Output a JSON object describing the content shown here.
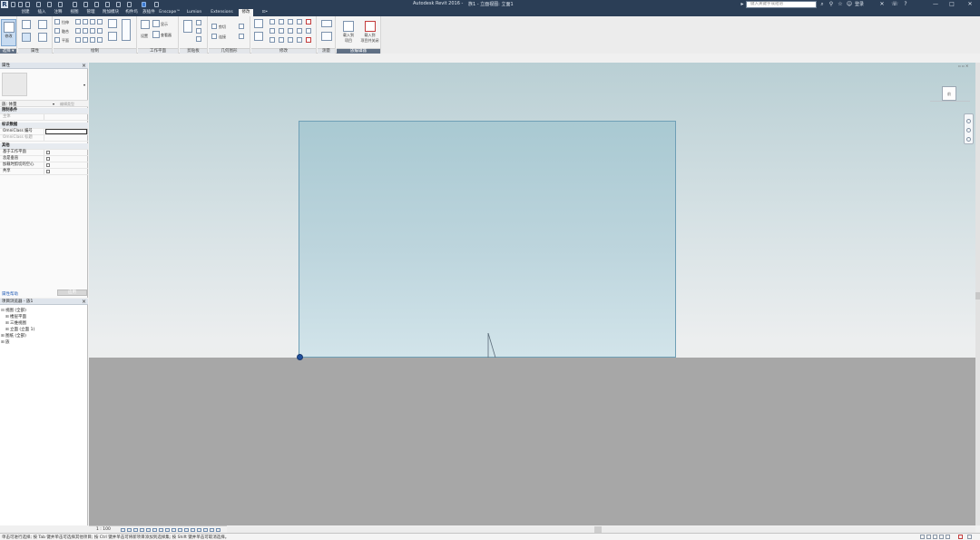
{
  "titlebar": {
    "app_letter": "R",
    "doc_title": "Autodesk Revit 2016 -",
    "view_name": "族1 - 立面视图: 立面1",
    "search_placeholder": "键入关键字或短语",
    "sign_in": "登录",
    "min": "—",
    "max": "□",
    "close": "✕",
    "help": "?"
  },
  "tabs": [
    {
      "label": "创建"
    },
    {
      "label": "插入"
    },
    {
      "label": "注释"
    },
    {
      "label": "视图"
    },
    {
      "label": "管理"
    },
    {
      "label": "附加模块"
    },
    {
      "label": "构件坞"
    },
    {
      "label": "族插件"
    },
    {
      "label": "Enscape™"
    },
    {
      "label": "Lumion"
    },
    {
      "label": "Extensions"
    },
    {
      "label": "修改"
    },
    {
      "label": "⊡•"
    }
  ],
  "ribbon": {
    "select_label": "选择 ▾",
    "properties_label": "属性",
    "draw_label": "绘制",
    "work_plane_label": "工作平面",
    "clipboard_label": "剪贴板",
    "geometry_label": "几何图形",
    "modify_label": "修改",
    "measure_label": "测量",
    "family_editor_label": "族编辑器",
    "modify_btn": "修改",
    "blend_btn": "融合",
    "sweep_btn": "放样",
    "plane_btn": "平面",
    "set_btn": "设置",
    "show_btn": "显示",
    "viewer_btn": "查看器",
    "cut_btn": "剪切",
    "join_btn": "连接",
    "load_project_btn": "载入到\n项目",
    "load_close_btn": "载入到\n项目并关闭"
  },
  "properties": {
    "title": "属性",
    "type_selector": "族: 体量",
    "edit_type": "编辑类型",
    "groups": [
      {
        "name": "限制条件"
      },
      {
        "name": "标识数据"
      },
      {
        "name": "其他"
      }
    ],
    "rows": [
      {
        "key": "主体"
      },
      {
        "key": "OmniClass 编号"
      },
      {
        "key": "OmniClass 标题"
      },
      {
        "key": "基于工作平面"
      },
      {
        "key": "总是垂直"
      },
      {
        "key": "加载时剪切的空心"
      },
      {
        "key": "共享"
      }
    ],
    "help_link": "属性帮助",
    "apply": "应用"
  },
  "browser": {
    "title": "项目浏览器 - 族1",
    "items": [
      {
        "label": "视图 (全部)",
        "twisty": "⊟"
      },
      {
        "label": "楼层平面",
        "twisty": "⊞"
      },
      {
        "label": "三维视图",
        "twisty": "⊞"
      },
      {
        "label": "立面 (立面 1)",
        "twisty": "⊞"
      },
      {
        "label": "图纸 (全部)",
        "twisty": "⊞"
      },
      {
        "label": "族",
        "twisty": "⊞"
      }
    ]
  },
  "view": {
    "scale": "1 : 100",
    "viewcube_face": "前"
  },
  "status": {
    "message": "单击可进行选择; 按 Tab 键并单击可选择其他项目; 按 Ctrl 键并单击可将新项目添加到选择集; 按 Shift 键并单击可取消选择。"
  },
  "colors": {
    "titlebar": "#2b3e56",
    "wall": "#b3cfd6",
    "ground": "#a7a7a7",
    "sky_top": "#b9cfd4"
  }
}
